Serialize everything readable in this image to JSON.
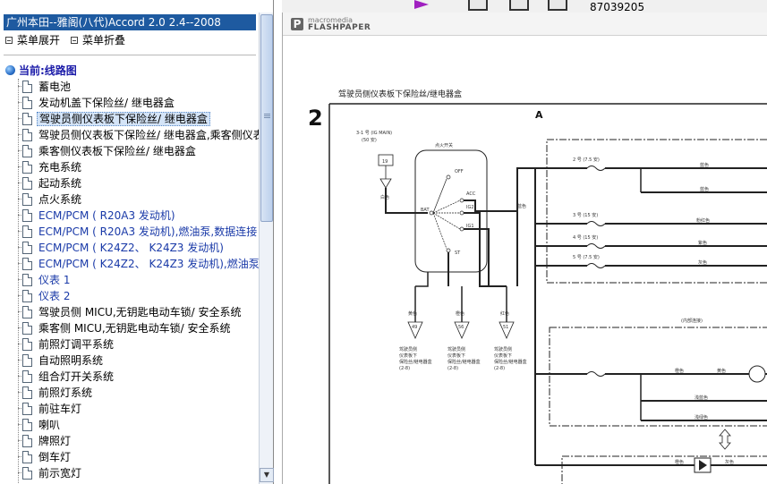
{
  "left_panel": {
    "title": "广州本田--雅阁(八代)Accord 2.0 2.4--2008",
    "expand_all": "菜单展开",
    "collapse_all": "菜单折叠",
    "current_label": "当前:线路图",
    "items": [
      {
        "label": "蓄电池"
      },
      {
        "label": "发动机盖下保险丝/ 继电器盒"
      },
      {
        "label": "驾驶员侧仪表板下保险丝/ 继电器盒",
        "selected": true
      },
      {
        "label": "驾驶员侧仪表板下保险丝/ 继电器盒,乘客侧仪表"
      },
      {
        "label": "乘客侧仪表板下保险丝/ 继电器盒"
      },
      {
        "label": "充电系统"
      },
      {
        "label": "起动系统"
      },
      {
        "label": "点火系统"
      },
      {
        "label": "ECM/PCM ( R20A3 发动机)"
      },
      {
        "label": "ECM/PCM ( R20A3 发动机),燃油泵,数据连接"
      },
      {
        "label": "ECM/PCM ( K24Z2、 K24Z3 发动机)"
      },
      {
        "label": "ECM/PCM ( K24Z2、 K24Z3 发动机),燃油泵"
      },
      {
        "label": "仪表 1"
      },
      {
        "label": "仪表 2"
      },
      {
        "label": "驾驶员侧 MICU,无钥匙电动车锁/ 安全系统"
      },
      {
        "label": "乘客侧 MICU,无钥匙电动车锁/ 安全系统"
      },
      {
        "label": "前照灯调平系统"
      },
      {
        "label": "自动照明系统"
      },
      {
        "label": "组合灯开关系统"
      },
      {
        "label": "前照灯系统"
      },
      {
        "label": "前驻车灯"
      },
      {
        "label": "喇叭"
      },
      {
        "label": "牌照灯"
      },
      {
        "label": "倒车灯"
      },
      {
        "label": "前示宽灯"
      }
    ]
  },
  "top_strip": {
    "number": "87039205"
  },
  "viewer": {
    "brand_top": "macromedia",
    "brand_bottom": "FLASHPAPER",
    "diagram": {
      "heading": "驾驶员侧仪表板下保险丝/继电器盒",
      "page_number": "2",
      "section": "A",
      "ig_main": "3-1 号 (IG MAIN)",
      "ig_main_amp": "(50 安)",
      "terminal_19": "19",
      "switch_title": "点火开关",
      "positions": [
        "OFF",
        "ACC",
        "IG2",
        "IG1",
        "BAT",
        "ST"
      ],
      "wire_white": "白色",
      "wire_red": "红色",
      "wire_orange": "橙色",
      "wire_blue": "蓝色",
      "wire_yellow": "黄色",
      "wire_purple": "紫色",
      "wire_gray": "灰色",
      "wire_pink": "粉红色",
      "wire_lt_blue": "浅蓝色",
      "wire_lt_green": "浅绿色",
      "fuses": [
        "2 号 (7.5 安)",
        "3 号 (15 安)",
        "4 号 (15 安)",
        "5 号 (7.5 安)"
      ],
      "conn_49": "49",
      "conn_56": "56",
      "conn_51": "51",
      "internal": "(内部连接)",
      "note_lines": [
        "驾驶员侧",
        "仪表板下",
        "保险丝/继电器盒",
        "(2-8)"
      ]
    }
  }
}
